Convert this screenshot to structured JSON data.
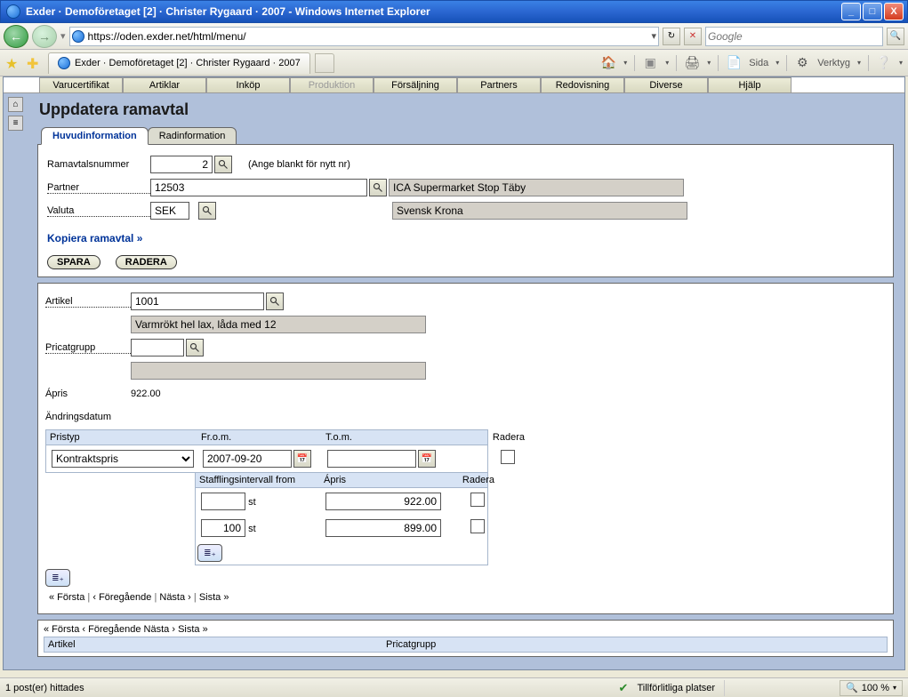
{
  "window": {
    "title": "Exder · Demoföretaget [2] · Christer Rygaard · 2007 - Windows Internet Explorer",
    "url": "https://oden.exder.net/html/menu/",
    "search_placeholder": "Google",
    "win_min": "_",
    "win_max": "□",
    "win_close": "X"
  },
  "tab": {
    "label": "Exder · Demoföretaget [2] · Christer Rygaard · 2007"
  },
  "tools": {
    "sida": "Sida",
    "verktyg": "Verktyg"
  },
  "menu": [
    "Varucertifikat",
    "Artiklar",
    "Inköp",
    "Produktion",
    "Försäljning",
    "Partners",
    "Redovisning",
    "Diverse",
    "Hjälp"
  ],
  "menu_disabled_index": 3,
  "page": {
    "title": "Uppdatera ramavtal",
    "tabs": [
      "Huvudinformation",
      "Radinformation"
    ],
    "active_tab": 0
  },
  "form": {
    "ramavtal_lbl": "Ramavtalsnummer",
    "ramavtal_val": "2",
    "ramavtal_hint": "(Ange blankt för nytt nr)",
    "partner_lbl": "Partner",
    "partner_val": "12503",
    "partner_name": "ICA Supermarket Stop Täby",
    "valuta_lbl": "Valuta",
    "valuta_val": "SEK",
    "valuta_name": "Svensk Krona",
    "copy_link": "Kopiera ramavtal »",
    "save_btn": "SPARA",
    "delete_btn": "RADERA"
  },
  "article": {
    "artikel_lbl": "Artikel",
    "artikel_val": "1001",
    "artikel_name": "Varmrökt hel lax, låda med 12",
    "pricat_lbl": "Pricatgrupp",
    "pricat_val": "",
    "pricat_name": "",
    "apris_lbl": "Ápris",
    "apris_val": "922.00",
    "datum_lbl": "Ändringsdatum"
  },
  "pris_header": {
    "typ": "Pristyp",
    "from": "Fr.o.m.",
    "tom": "T.o.m.",
    "radera": "Radera"
  },
  "pris_row": {
    "typ": "Kontraktspris",
    "from": "2007-09-20",
    "tom": ""
  },
  "staf_header": {
    "from": "Stafflingsintervall from",
    "apris": "Ápris",
    "radera": "Radera"
  },
  "staf_rows": [
    {
      "qty": "",
      "unit": "st",
      "apris": "922.00"
    },
    {
      "qty": "100",
      "unit": "st",
      "apris": "899.00"
    }
  ],
  "pager1": {
    "first": "« Första",
    "prev": "‹ Föregående",
    "next": "Nästa ›",
    "last": "Sista »"
  },
  "pager2": {
    "first": "« Första",
    "prev": "‹ Föregående",
    "next": "Nästa ›",
    "last": "Sista »"
  },
  "cols": {
    "artikel": "Artikel",
    "pricat": "Pricatgrupp"
  },
  "status": {
    "left": "1 post(er) hittades",
    "trust": "Tillförlitliga platser",
    "zoom": "100 %"
  }
}
